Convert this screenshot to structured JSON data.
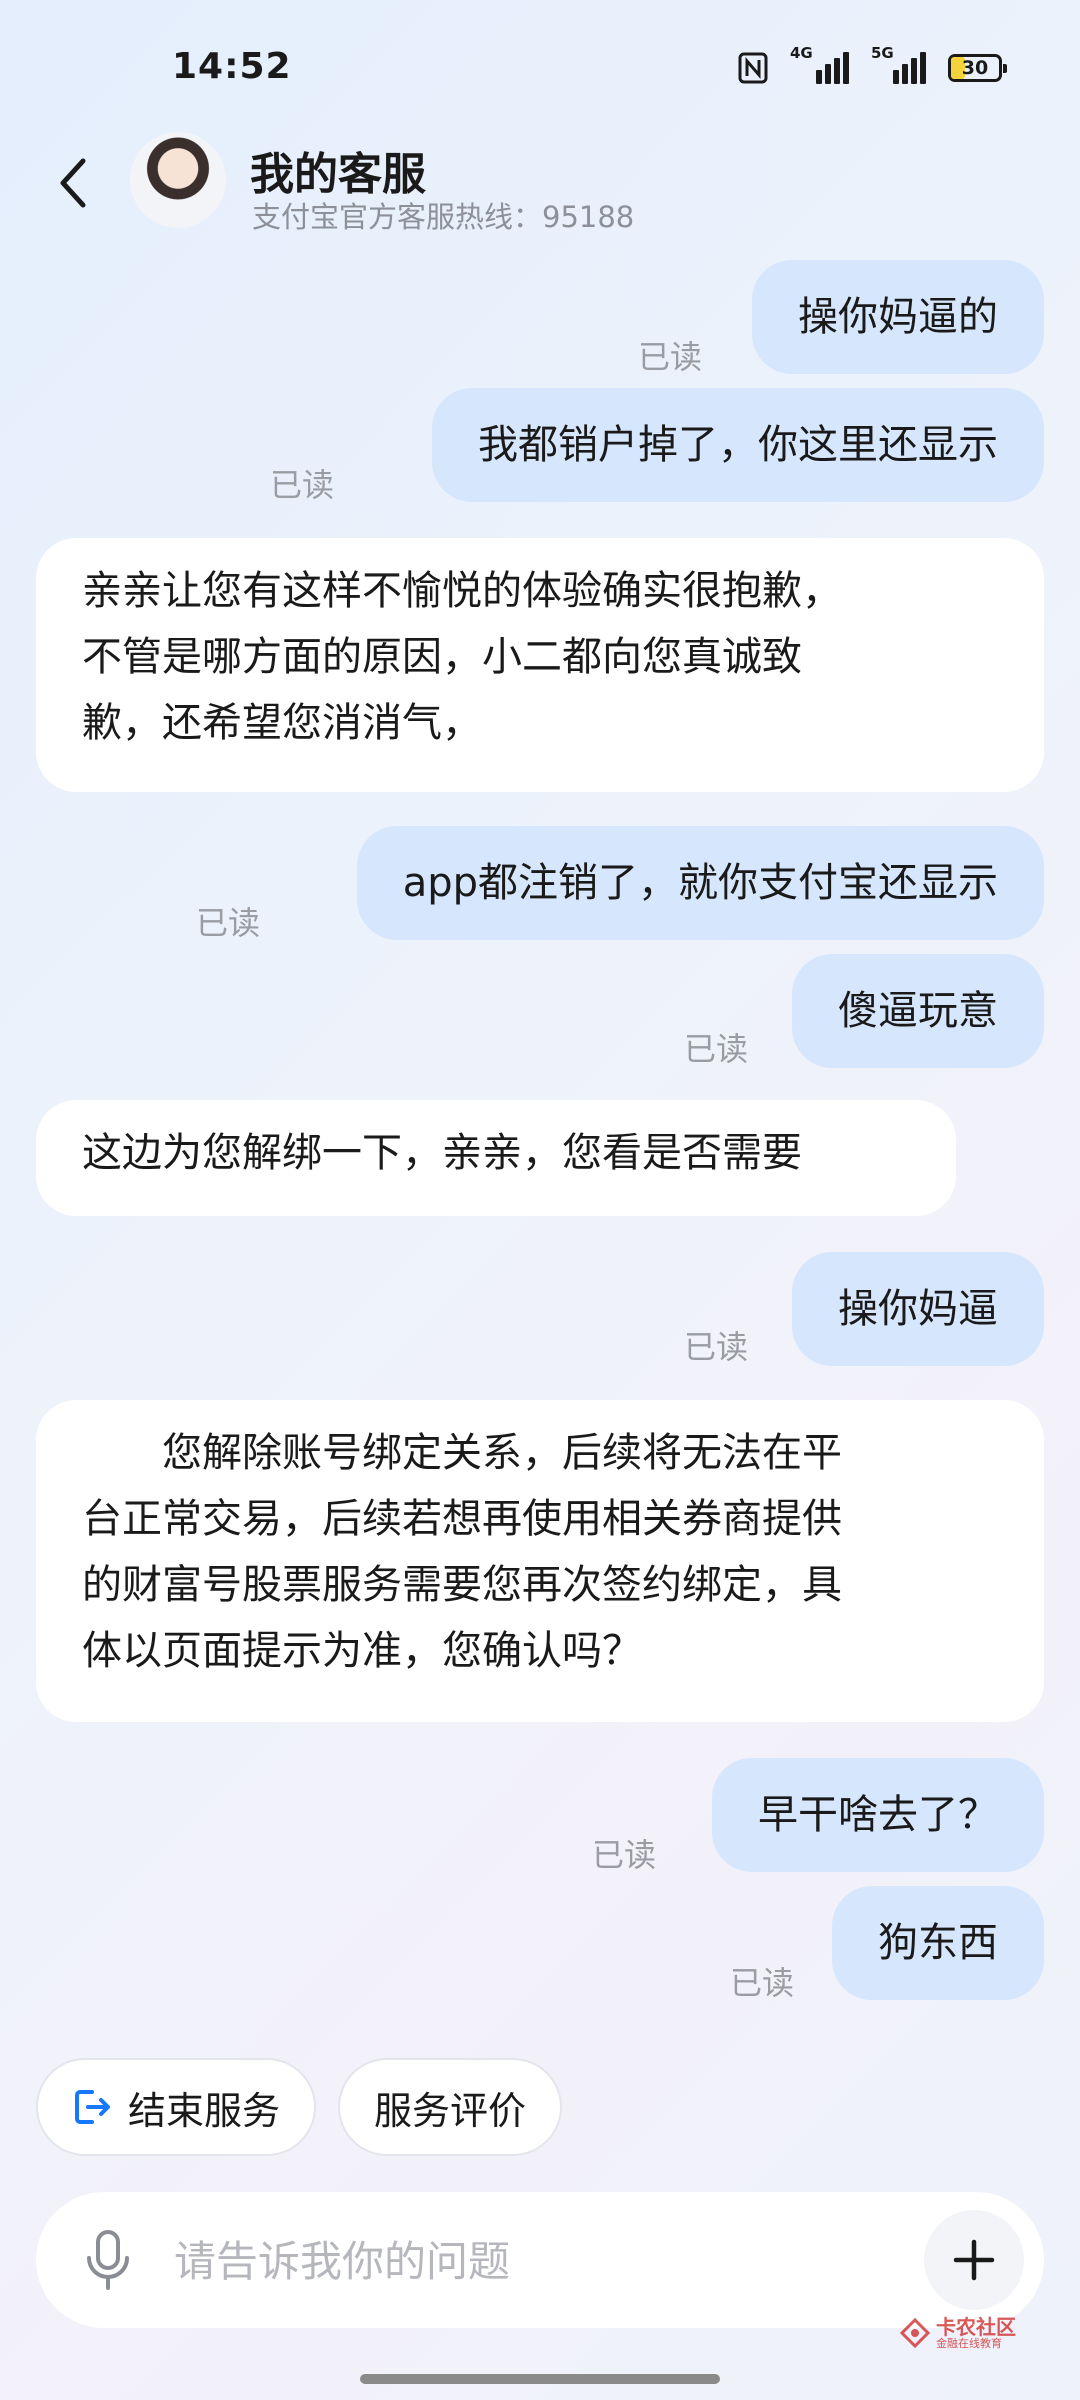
{
  "status_bar": {
    "time": "14:52",
    "net1": "4G",
    "net2": "5G",
    "battery": "30"
  },
  "header": {
    "title": "我的客服",
    "subtitle": "支付宝官方客服热线：95188"
  },
  "read_label": "已读",
  "messages": [
    {
      "from": "user",
      "text": "操你妈逼的"
    },
    {
      "from": "user",
      "text": "我都销户掉了，你这里还显示"
    },
    {
      "from": "bot",
      "lines": [
        "亲亲让您有这样不愉悦的体验确实很抱歉，",
        "不管是哪方面的原因，小二都向您真诚致",
        "歉，还希望您消消气，"
      ]
    },
    {
      "from": "user",
      "text": "app都注销了，就你支付宝还显示"
    },
    {
      "from": "user",
      "text": "傻逼玩意"
    },
    {
      "from": "bot",
      "lines": [
        "这边为您解绑一下，亲亲，您看是否需要"
      ]
    },
    {
      "from": "user",
      "text": "操你妈逼"
    },
    {
      "from": "bot",
      "lines": [
        "　　您解除账号绑定关系，后续将无法在平",
        "台正常交易，后续若想再使用相关券商提供",
        "的财富号股票服务需要您再次签约绑定，具",
        "体以页面提示为准，您确认吗？"
      ]
    },
    {
      "from": "user",
      "text": "早干啥去了？"
    },
    {
      "from": "user",
      "text": "狗东西"
    }
  ],
  "quick_actions": {
    "end_service": "结束服务",
    "rate_service": "服务评价"
  },
  "input": {
    "placeholder": "请告诉我你的问题"
  },
  "watermark": {
    "main": "卡农社区",
    "sub": "金融在线教育"
  },
  "colors": {
    "user_bubble": "#d6e6fd",
    "bot_bubble": "#ffffff",
    "accent": "#1677ff"
  }
}
